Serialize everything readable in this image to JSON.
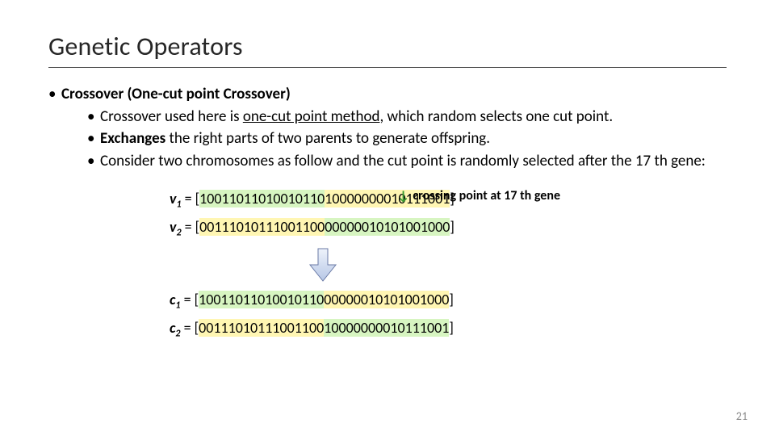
{
  "title": "Genetic Operators",
  "bullet_main": "Crossover (One-cut point Crossover)",
  "sub1_a": "Crossover used here is ",
  "sub1_b": "one-cut point method",
  "sub1_c": ", which random selects one cut point.",
  "sub2_a": "Exchanges",
  "sub2_b": " the right parts of two parents to generate offspring.",
  "sub3": "Consider two chromosomes as follow and the cut point is randomly selected after the 17 th gene:",
  "annot": "crossing point at 17 th gene",
  "labels": {
    "v1": "v",
    "v1s": "1",
    "v2": "v",
    "v2s": "2",
    "c1": "c",
    "c1s": "1",
    "c2": "c",
    "c2s": "2"
  },
  "eq": " = [",
  "close": "]",
  "v1_left": "10011011010010110",
  "v1_right": "10000000010111001",
  "v2_left": "00111010111001100",
  "v2_right": "00000010101001000",
  "c1_left": "10011011010010110",
  "c1_right": "00000010101001000",
  "c2_left": "00111010111001100",
  "c2_right": "10000000010111001",
  "page": "21"
}
